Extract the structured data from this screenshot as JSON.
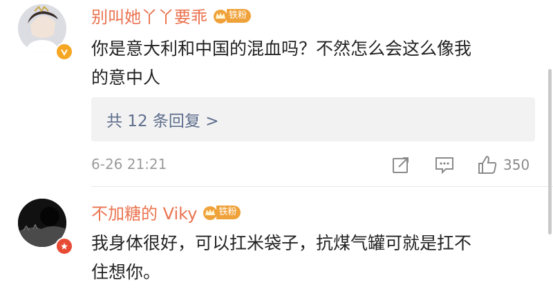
{
  "comments": [
    {
      "username": "别叫她丫丫要乖",
      "fan_badge": "铁粉",
      "text_line1": "你是意大利和中国的混血吗？不然怎么会这么像我",
      "text_line2": "的意中人",
      "replies_label": "共 12 条回复 >",
      "timestamp": "6-26 21:21",
      "like_count": "350",
      "verified_badge_icon": "verified-v-icon"
    },
    {
      "username": "不加糖的 Viky",
      "fan_badge": "铁粉",
      "text_line1": "我身体很好，可以扛米袋子，抗煤气罐可就是扛不",
      "text_line2": "住想你。",
      "verified_badge_icon": "red-star-badge-icon"
    }
  ],
  "icons": {
    "repost": "repost-icon",
    "comment": "comment-icon",
    "like": "thumbs-up-icon"
  },
  "colors": {
    "username": "#eb7350",
    "fan_badge": "#f0a23a",
    "reply_link": "#5d6d8c",
    "meta": "#9b9b9b"
  }
}
